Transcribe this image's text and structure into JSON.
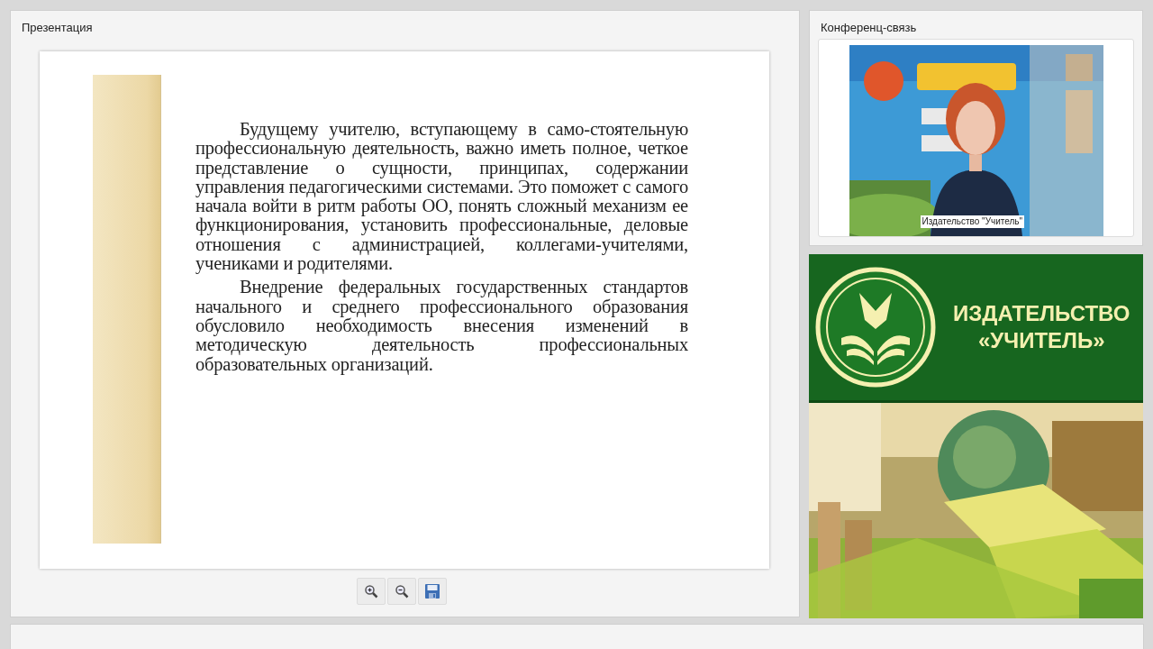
{
  "presentation": {
    "title": "Презентация",
    "slide": {
      "paragraphs": [
        "Будущему учителю, вступающему в само-стоятельную профессиональную деятельность, важно иметь полное, четкое представление о сущности, принципах, содержании управления педагогическими системами. Это поможет с самого начала войти в ритм работы ОО, понять сложный механизм ее функционирования, установить профессиональные, деловые отношения с администрацией, коллегами-учителями, учениками и родителями.",
        "Внедрение федеральных государственных стандартов начального и среднего профессионального образования обусловило необходимость внесения изменений в методическую деятельность профессиональных образовательных организаций."
      ]
    },
    "toolbar": [
      {
        "kind": "zoom-in"
      },
      {
        "kind": "zoom-out"
      },
      {
        "kind": "save"
      }
    ]
  },
  "conference": {
    "title": "Конференц-связь",
    "video": {
      "kind": "picture",
      "caption": "Издательство \"Учитель\""
    }
  },
  "banner": {
    "lines": [
      "ИЗДАТЕЛЬСТВО",
      "«УЧИТЕЛЬ»"
    ],
    "photo": {
      "kind": "picture"
    }
  }
}
